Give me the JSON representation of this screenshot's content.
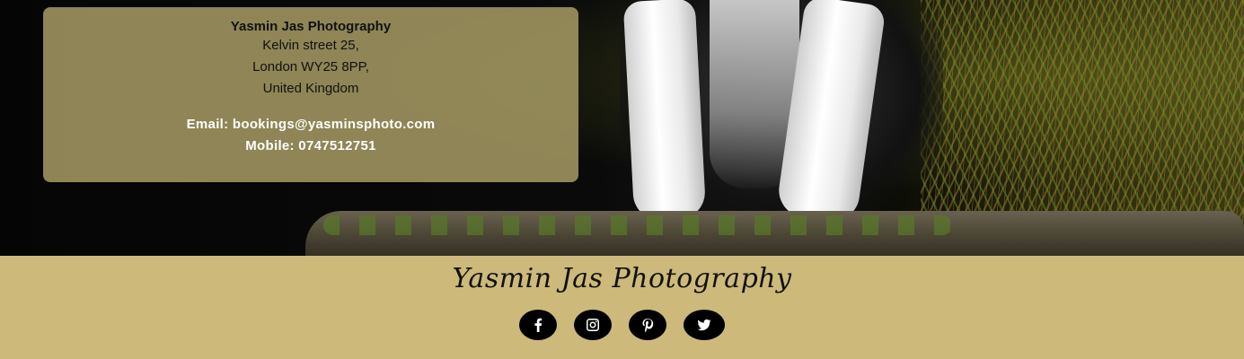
{
  "card": {
    "name": "Yasmin Jas Photography",
    "address_lines": [
      "Kelvin street 25,",
      "London WY25 8PP,",
      "United Kingdom"
    ],
    "email_line": "Email: bookings@yasminsphoto.com",
    "mobile_line": "Mobile: 0747512751"
  },
  "footer": {
    "brand": "Yasmin Jas Photography",
    "socials": [
      {
        "name": "facebook",
        "icon": "facebook-icon"
      },
      {
        "name": "instagram",
        "icon": "instagram-icon"
      },
      {
        "name": "pinterest",
        "icon": "pinterest-icon"
      },
      {
        "name": "twitter",
        "icon": "twitter-icon"
      }
    ]
  },
  "colors": {
    "card_bg": "#ada168",
    "footer_bg": "#cdb97a",
    "social_bg": "#000000"
  }
}
